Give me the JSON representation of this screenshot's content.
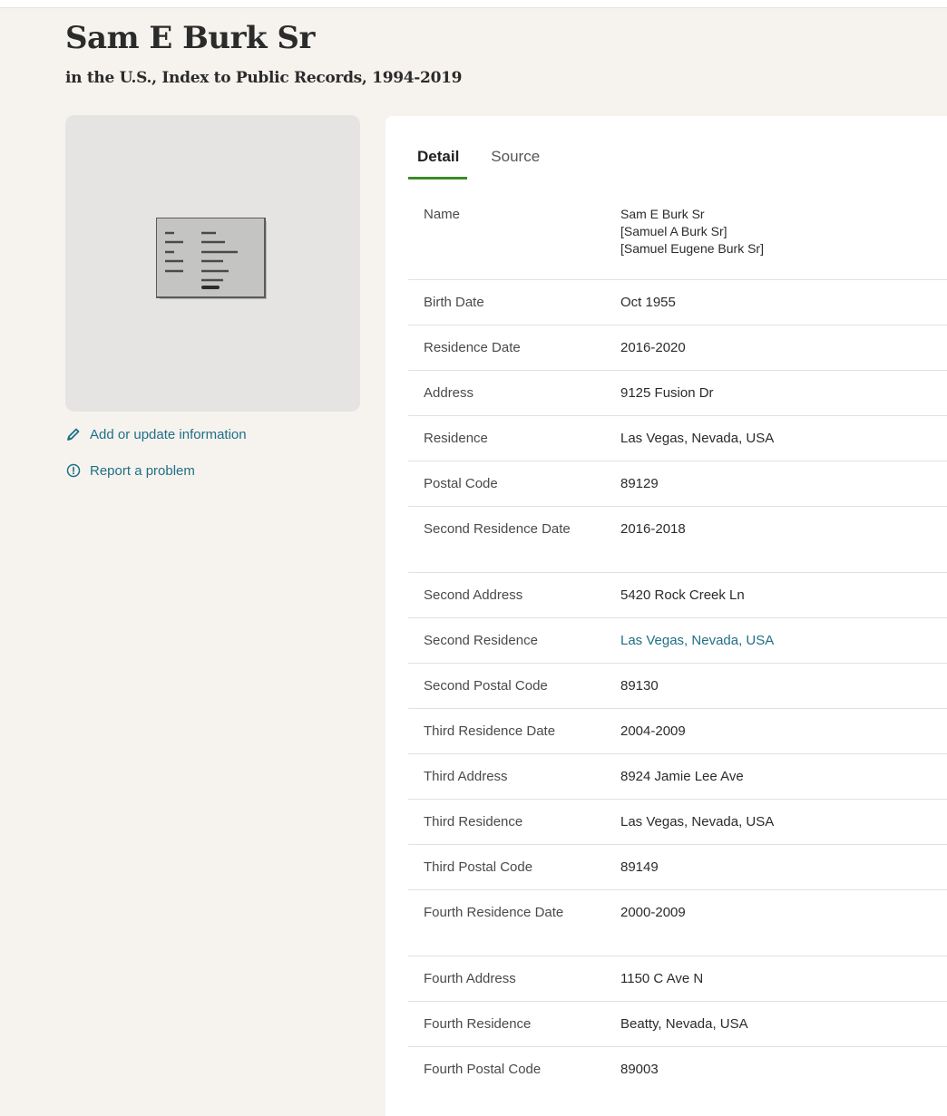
{
  "header": {
    "title": "Sam E Burk Sr",
    "subtitle": "in the U.S., Index to Public Records, 1994-2019"
  },
  "sidebar": {
    "add_update_label": "Add or update information",
    "report_label": "Report a problem",
    "thumbnail_icon": "document-card-icon",
    "add_icon": "pencil-icon",
    "report_icon": "info-circle-icon"
  },
  "tabs": [
    {
      "label": "Detail",
      "active": true
    },
    {
      "label": "Source",
      "active": false
    }
  ],
  "detail": {
    "name_label": "Name",
    "name_values": [
      "Sam E Burk Sr",
      "[Samuel A Burk Sr]",
      "[Samuel Eugene Burk Sr]"
    ],
    "rows": [
      {
        "label": "Birth Date",
        "value": "Oct 1955"
      },
      {
        "label": "Residence Date",
        "value": "2016-2020"
      },
      {
        "label": "Address",
        "value": "9125 Fusion Dr"
      },
      {
        "label": "Residence",
        "value": "Las Vegas, Nevada, USA"
      },
      {
        "label": "Postal Code",
        "value": "89129"
      },
      {
        "label": "Second Residence Date",
        "value": "2016-2018"
      },
      {
        "label": "Second Address",
        "value": "5420 Rock Creek Ln"
      },
      {
        "label": "Second Residence",
        "value": "Las Vegas, Nevada, USA"
      },
      {
        "label": "Second Postal Code",
        "value": "89130"
      },
      {
        "label": "Third Residence Date",
        "value": "2004-2009"
      },
      {
        "label": "Third Address",
        "value": "8924 Jamie Lee Ave"
      },
      {
        "label": "Third Residence",
        "value": "Las Vegas, Nevada, USA"
      },
      {
        "label": "Third Postal Code",
        "value": "89149"
      },
      {
        "label": "Fourth Residence Date",
        "value": "2000-2009"
      },
      {
        "label": "Fourth Address",
        "value": "1150 C Ave N"
      },
      {
        "label": "Fourth Residence",
        "value": "Beatty, Nevada, USA"
      },
      {
        "label": "Fourth Postal Code",
        "value": "89003"
      }
    ]
  },
  "colors": {
    "link": "#1f6f86",
    "tab_underline": "#3c8a2a",
    "page_background": "#f6f3ef"
  }
}
